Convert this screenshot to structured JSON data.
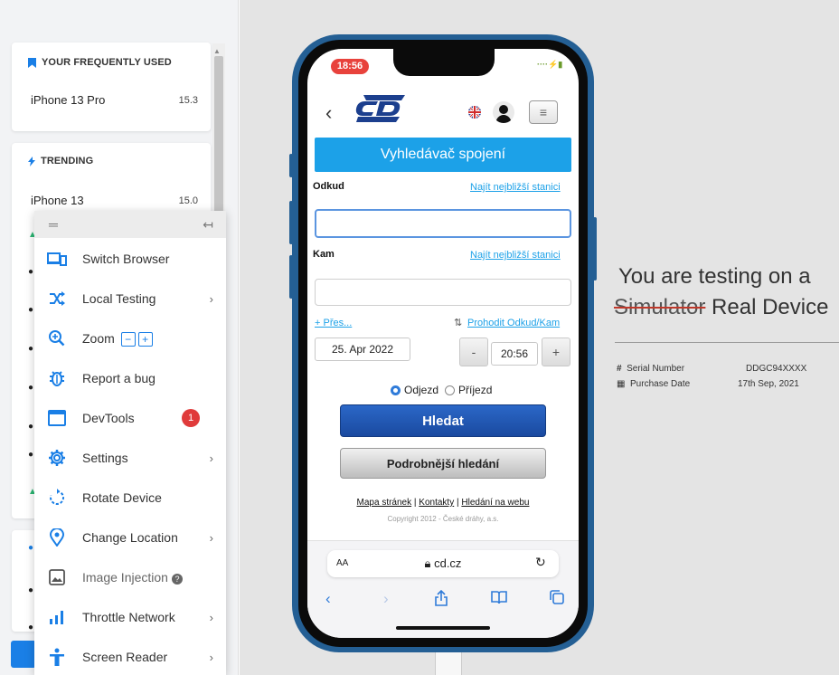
{
  "sidebar": {
    "frequently_used": {
      "title": "YOUR FREQUENTLY USED",
      "devices": [
        {
          "name": "iPhone 13 Pro",
          "version": "15.3"
        }
      ]
    },
    "trending": {
      "title": "TRENDING",
      "devices": [
        {
          "name": "iPhone 13",
          "version": "15.0"
        }
      ]
    }
  },
  "menu": {
    "items": [
      {
        "label": "Switch Browser",
        "icon": "switch-browser-icon"
      },
      {
        "label": "Local Testing",
        "icon": "local-testing-icon",
        "has_submenu": true
      },
      {
        "label": "Zoom",
        "icon": "zoom-icon",
        "minus": "−",
        "plus": "+"
      },
      {
        "label": "Report a bug",
        "icon": "bug-icon"
      },
      {
        "label": "DevTools",
        "icon": "devtools-icon",
        "badge": "1"
      },
      {
        "label": "Settings",
        "icon": "gear-icon",
        "has_submenu": true
      },
      {
        "label": "Rotate Device",
        "icon": "rotate-icon"
      },
      {
        "label": "Change Location",
        "icon": "location-pin-icon",
        "has_submenu": true
      },
      {
        "label": "Image Injection",
        "icon": "image-icon",
        "disabled": true
      },
      {
        "label": "Throttle Network",
        "icon": "signal-bars-icon",
        "has_submenu": true
      },
      {
        "label": "Screen Reader",
        "icon": "accessibility-icon",
        "has_submenu": true
      }
    ]
  },
  "phone": {
    "status_time": "18:56",
    "page": {
      "banner": "Vyhledávač spojení",
      "from_label": "Odkud",
      "nearest_link": "Najít nejbližší stanici",
      "to_label": "Kam",
      "via_link": "+ Přes...",
      "swap_link": "Prohodit Odkud/Kam",
      "date": "25. Apr 2022",
      "minus": "-",
      "time": "20:56",
      "plus": "+",
      "departure": "Odjezd",
      "arrival": "Příjezd",
      "search_button": "Hledat",
      "advanced_button": "Podrobnější hledání",
      "footer_links": [
        "Mapa stránek",
        "Kontakty",
        "Hledání na webu"
      ],
      "copyright": "Copyright 2012 - České dráhy, a.s."
    },
    "safari": {
      "aa": "AA",
      "url": "cd.cz"
    }
  },
  "info": {
    "title_line1": "You are testing on a",
    "struck": "Simulator",
    "real": "Real Device",
    "serial_label": "Serial Number",
    "serial_value": "DDGC94XXXX",
    "purchase_label": "Purchase Date",
    "purchase_value": "17th Sep, 2021"
  },
  "colors": {
    "accent": "#1a7fe6",
    "banner": "#1ca1e8",
    "phone_frame": "#245f94",
    "badge": "#e03b3b"
  }
}
